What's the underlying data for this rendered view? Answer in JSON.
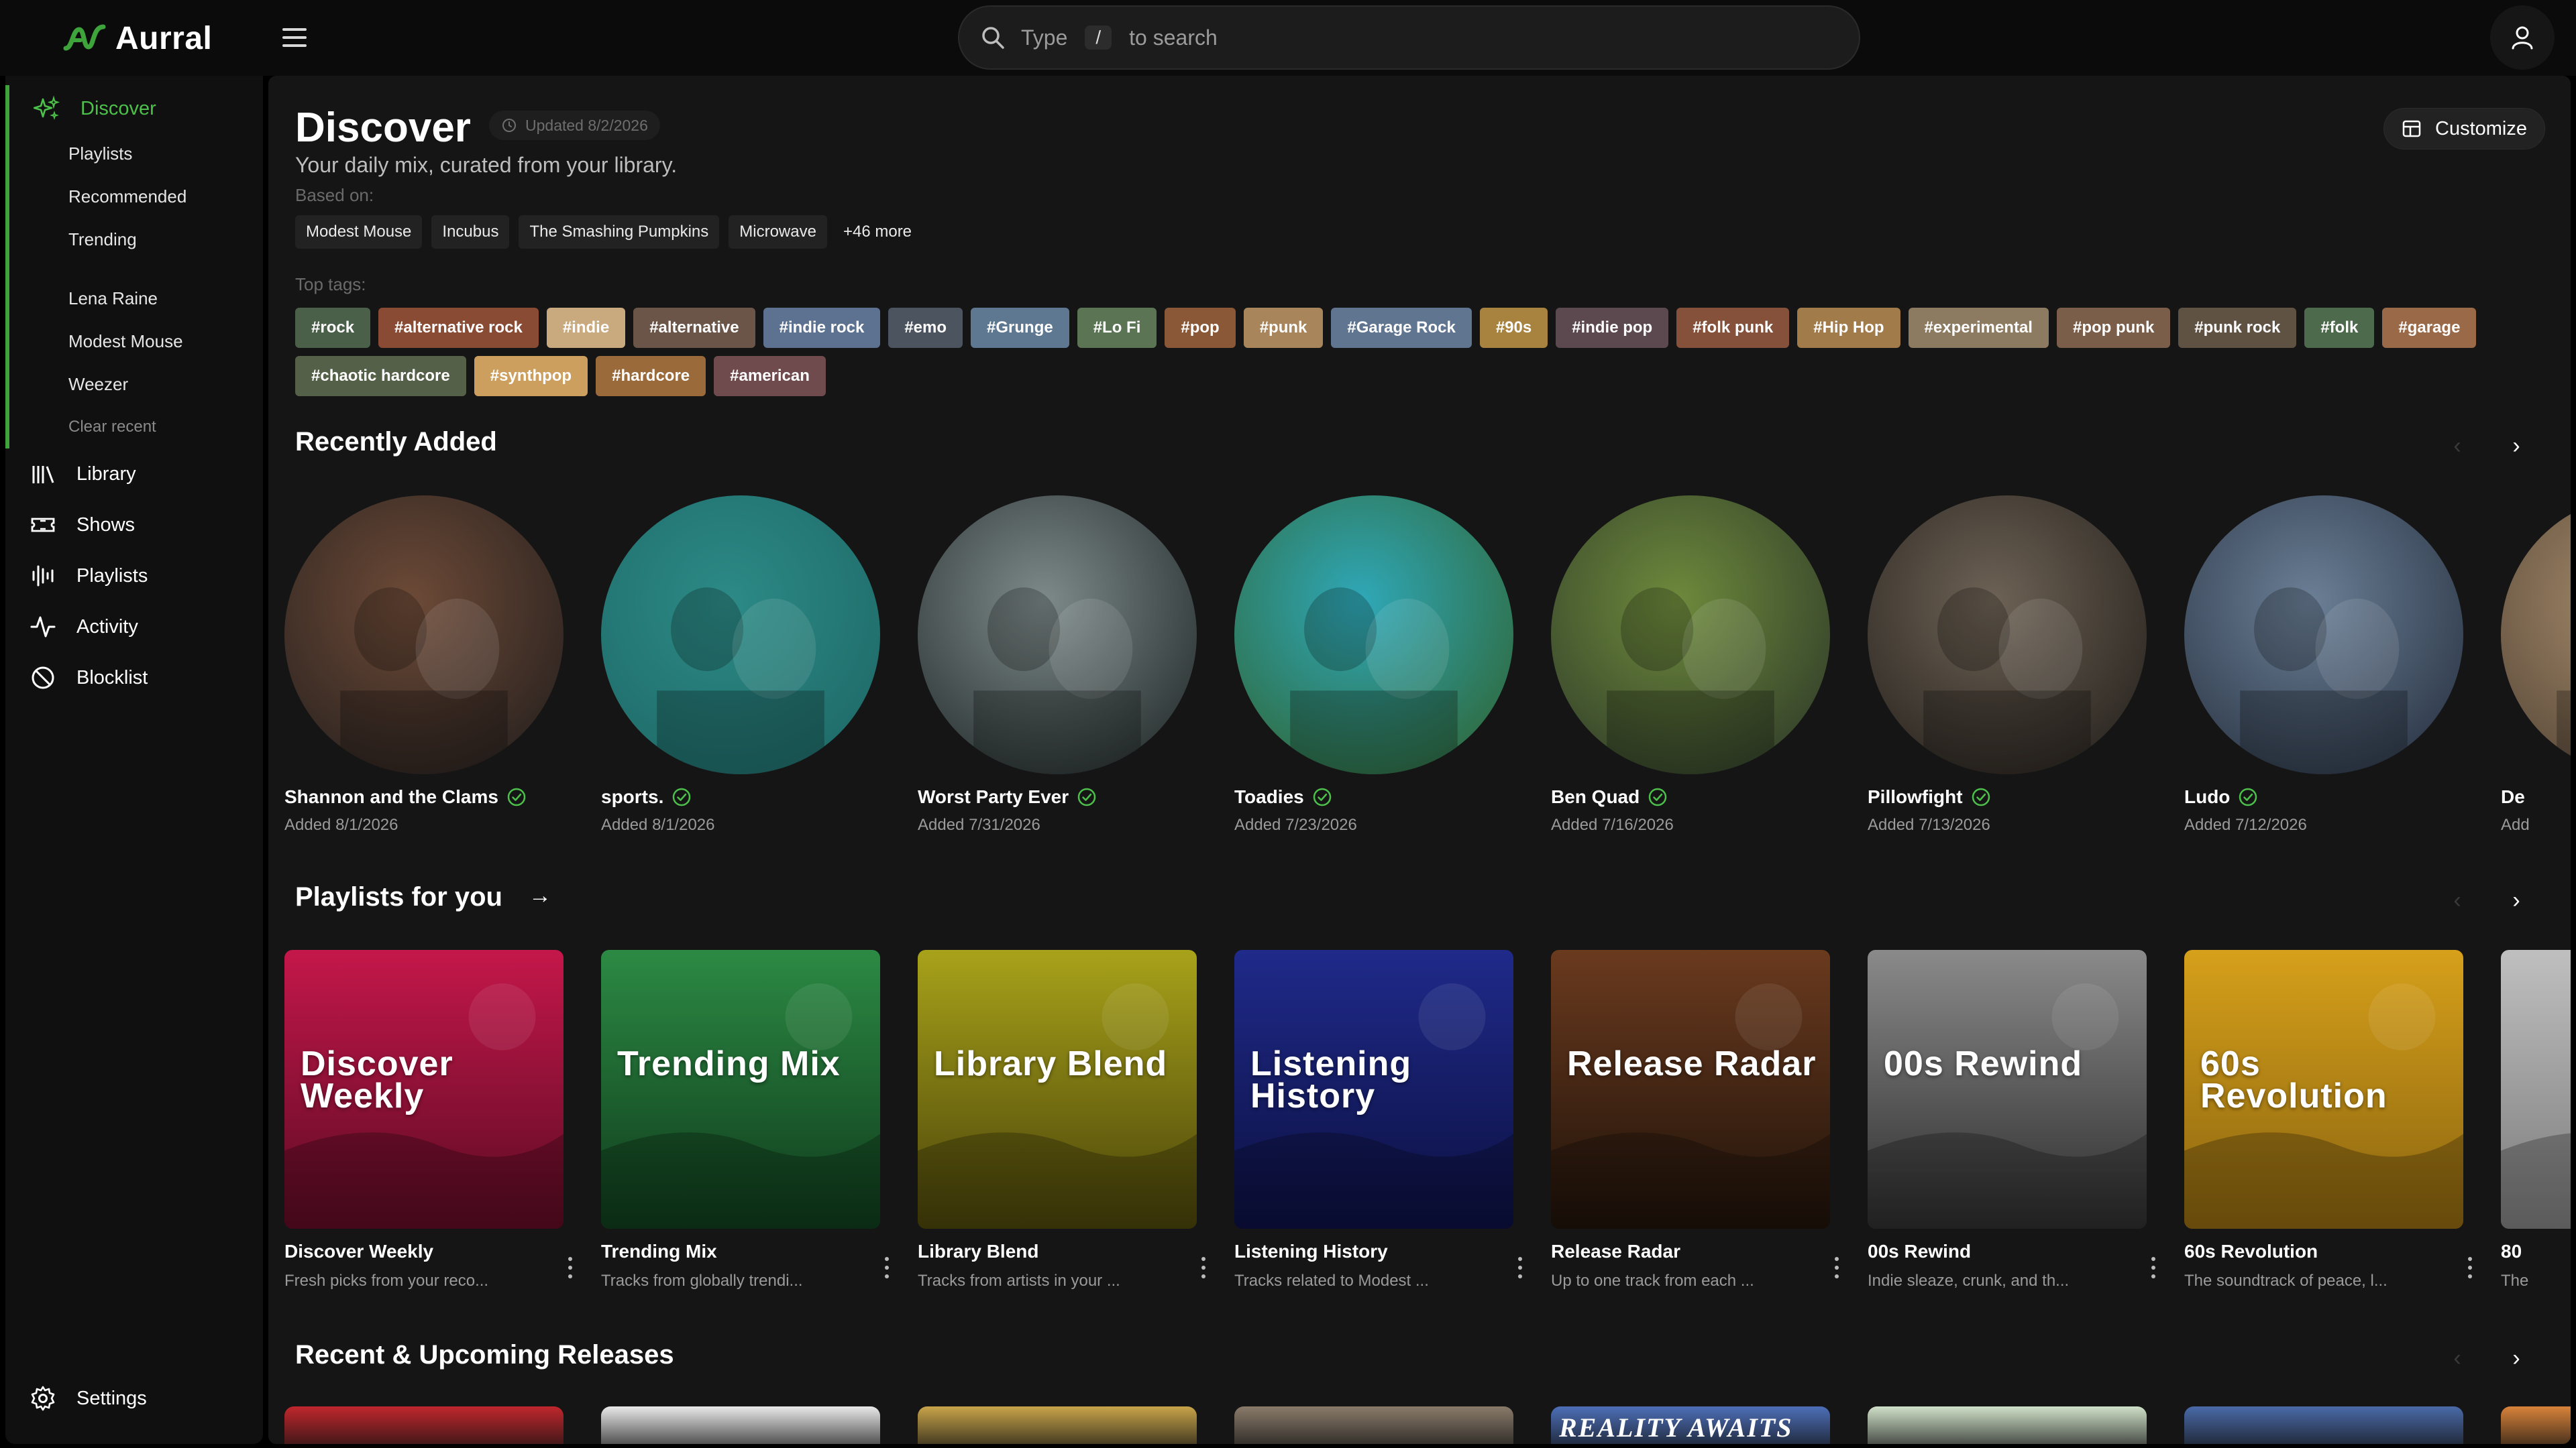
{
  "app": {
    "name": "Aurral",
    "accent": "#3ea33a"
  },
  "search": {
    "placeholder_prefix": "Type",
    "shortcut_key": "/",
    "placeholder_suffix": "to search"
  },
  "sidebar": {
    "discover_label": "Discover",
    "discover_subitems": [
      "Playlists",
      "Recommended",
      "Trending"
    ],
    "recent_artists": [
      "Lena Raine",
      "Modest Mouse",
      "Weezer"
    ],
    "clear_recent": "Clear recent",
    "items": [
      {
        "label": "Library",
        "icon": "library-icon"
      },
      {
        "label": "Shows",
        "icon": "ticket-icon"
      },
      {
        "label": "Playlists",
        "icon": "playlist-icon"
      },
      {
        "label": "Activity",
        "icon": "activity-icon"
      },
      {
        "label": "Blocklist",
        "icon": "block-icon"
      }
    ],
    "settings_label": "Settings"
  },
  "header": {
    "title": "Discover",
    "updated": "Updated 8/2/2026",
    "customize_label": "Customize",
    "subtitle": "Your daily mix, curated from your library.",
    "based_on_label": "Based on:",
    "based_on_artists": [
      "Modest Mouse",
      "Incubus",
      "The Smashing Pumpkins",
      "Microwave"
    ],
    "based_on_more": "+46 more",
    "top_tags_label": "Top tags:",
    "tags": [
      {
        "label": "#rock",
        "color": "#4a6049"
      },
      {
        "label": "#alternative rock",
        "color": "#8a4b35"
      },
      {
        "label": "#indie",
        "color": "#c9a97e"
      },
      {
        "label": "#alternative",
        "color": "#6a5548"
      },
      {
        "label": "#indie rock",
        "color": "#5d7290"
      },
      {
        "label": "#emo",
        "color": "#4c555f"
      },
      {
        "label": "#Grunge",
        "color": "#5d7890"
      },
      {
        "label": "#Lo Fi",
        "color": "#5a7454"
      },
      {
        "label": "#pop",
        "color": "#8a5837"
      },
      {
        "label": "#punk",
        "color": "#a8855b"
      },
      {
        "label": "#Garage Rock",
        "color": "#5f7590"
      },
      {
        "label": "#90s",
        "color": "#a8823f"
      },
      {
        "label": "#indie pop",
        "color": "#5c4950"
      },
      {
        "label": "#folk punk",
        "color": "#86513b"
      },
      {
        "label": "#Hip Hop",
        "color": "#a27b4b"
      },
      {
        "label": "#experimental",
        "color": "#8c7a61"
      },
      {
        "label": "#pop punk",
        "color": "#7b5e49"
      },
      {
        "label": "#punk rock",
        "color": "#5f5243"
      },
      {
        "label": "#folk",
        "color": "#4e6a4c"
      },
      {
        "label": "#garage",
        "color": "#9a6a48"
      },
      {
        "label": "#chaotic hardcore",
        "color": "#556048"
      },
      {
        "label": "#synthpop",
        "color": "#cd9f5f"
      },
      {
        "label": "#hardcore",
        "color": "#9a6a3b"
      },
      {
        "label": "#american",
        "color": "#6f4b4e"
      }
    ]
  },
  "recently_added": {
    "title": "Recently Added",
    "items": [
      {
        "name": "Shannon and the Clams",
        "added": "Added 8/1/2026",
        "color_a": "#6d4a37",
        "color_b": "#2b2320"
      },
      {
        "name": "sports.",
        "added": "Added 8/1/2026",
        "color_a": "#2c8a86",
        "color_b": "#1f6b69"
      },
      {
        "name": "Worst Party Ever",
        "added": "Added 7/31/2026",
        "color_a": "#7e8a8a",
        "color_b": "#2a3232"
      },
      {
        "name": "Toadies",
        "added": "Added 7/23/2026",
        "color_a": "#2fa8b8",
        "color_b": "#2f6a3e"
      },
      {
        "name": "Ben Quad",
        "added": "Added 7/16/2026",
        "color_a": "#6e8a3c",
        "color_b": "#33402a"
      },
      {
        "name": "Pillowfight",
        "added": "Added 7/13/2026",
        "color_a": "#6d6255",
        "color_b": "#2b2621"
      },
      {
        "name": "Ludo",
        "added": "Added 7/12/2026",
        "color_a": "#6b7f96",
        "color_b": "#2d3848"
      },
      {
        "name": "De",
        "added": "Add",
        "color_a": "#a58a6a",
        "color_b": "#5a4a3a"
      }
    ]
  },
  "playlists": {
    "title": "Playlists for you",
    "items": [
      {
        "cover": "Discover Weekly",
        "name": "Discover Weekly",
        "desc": "Fresh picks from your reco...",
        "color": "#c4174a",
        "shade": "#5a0b23"
      },
      {
        "cover": "Trending Mix",
        "name": "Trending Mix",
        "desc": "Tracks from globally trendi...",
        "color": "#2c8a44",
        "shade": "#0f3a1b"
      },
      {
        "cover": "Library Blend",
        "name": "Library Blend",
        "desc": "Tracks from artists in your ...",
        "color": "#a8a21a",
        "shade": "#48420a"
      },
      {
        "cover": "Listening History",
        "name": "Listening History",
        "desc": "Tracks related to Modest ...",
        "color": "#1f2a8a",
        "shade": "#0c1040"
      },
      {
        "cover": "Release Radar",
        "name": "Release Radar",
        "desc": "Up to one track from each ...",
        "color": "#6a3a1e",
        "shade": "#1e120a"
      },
      {
        "cover": "00s Rewind",
        "name": "00s Rewind",
        "desc": "Indie sleaze, crunk, and th...",
        "color": "#8a8a8a",
        "shade": "#2c2c2c"
      },
      {
        "cover": "60s Revolution",
        "name": "60s Revolution",
        "desc": "The soundtrack of peace, l...",
        "color": "#d6a01a",
        "shade": "#8a6410"
      },
      {
        "cover": "",
        "name": "80",
        "desc": "The",
        "color": "#bfbfbf",
        "shade": "#7a7a7a"
      }
    ]
  },
  "releases": {
    "title": "Recent & Upcoming Releases",
    "banner_text": "REALITY AWAITS",
    "tiles": [
      "#c0272d",
      "#e9e9e9",
      "#c8a44a",
      "#8a7b6a",
      "#4d6fb8",
      "#cfe0c8",
      "#4a6aa8",
      "#d8833a"
    ]
  }
}
